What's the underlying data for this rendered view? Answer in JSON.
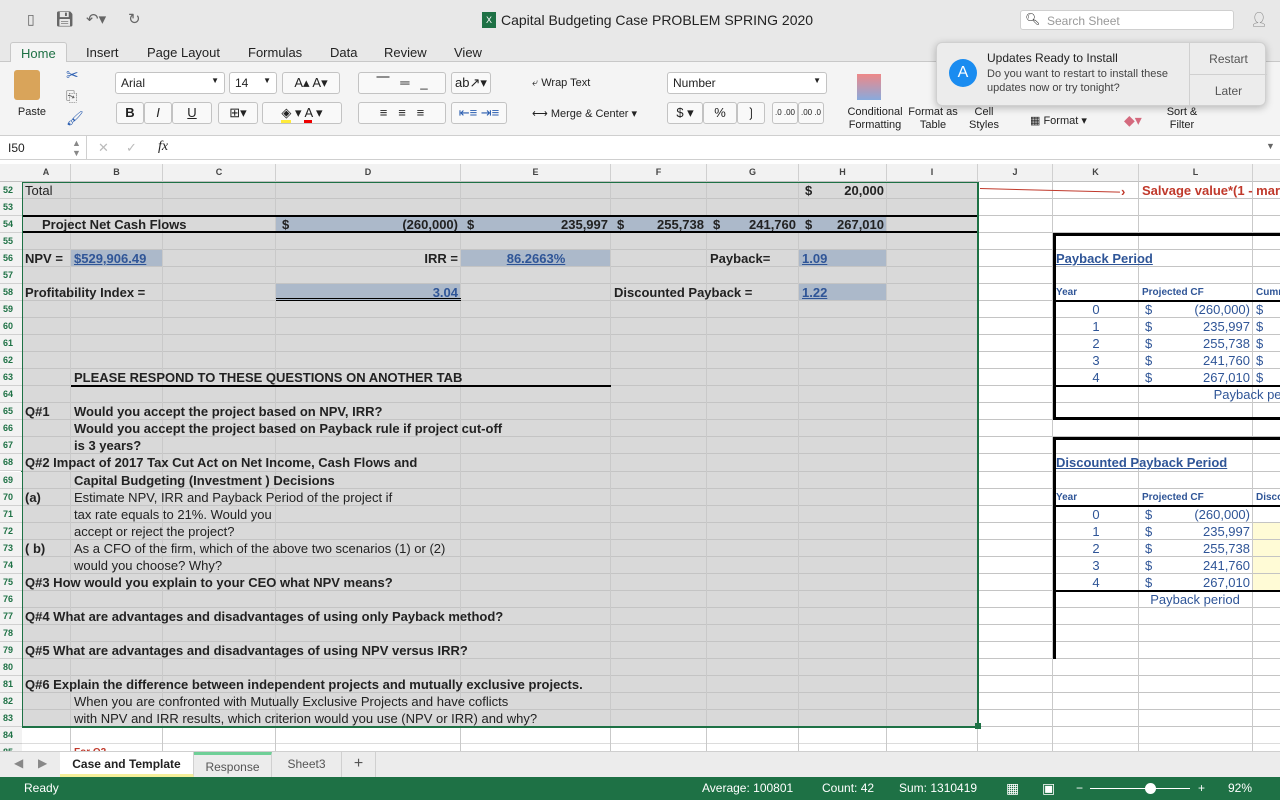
{
  "window": {
    "title": "Capital Budgeting Case PROBLEM SPRING 2020",
    "search_placeholder": "Search Sheet"
  },
  "ribbon_tabs": [
    "Home",
    "Insert",
    "Page Layout",
    "Formulas",
    "Data",
    "Review",
    "View"
  ],
  "ribbon": {
    "paste": "Paste",
    "font": "Arial",
    "font_size": "14",
    "bold": "B",
    "italic": "I",
    "underline": "U",
    "wrap_text": "Wrap Text",
    "merge_center": "Merge & Center",
    "number_format": "Number",
    "currency": "$",
    "percent": "%",
    "comma": "❳",
    "inc_dec": ".0 .00",
    "dec_dec": ".00 .0",
    "conditional_formatting": "Conditional Formatting",
    "format_as_table": "Format as Table",
    "cell_styles": "Cell Styles",
    "format": "Format",
    "sort_filter": "Sort & Filter"
  },
  "notification": {
    "title": "Updates Ready to Install",
    "body": "Do you want to restart to install these updates now or try tonight?",
    "restart": "Restart",
    "later": "Later"
  },
  "formula_bar": {
    "name_box": "I50",
    "fx": "fx",
    "value": ""
  },
  "columns": [
    "A",
    "B",
    "C",
    "D",
    "E",
    "F",
    "G",
    "H",
    "I",
    "J",
    "K",
    "L"
  ],
  "rows": [
    52,
    53,
    54,
    55,
    56,
    57,
    58,
    59,
    60,
    61,
    62,
    63,
    64,
    65,
    66,
    67,
    68,
    69,
    70,
    71,
    72,
    73,
    74,
    75,
    76,
    77,
    78,
    79,
    80,
    81,
    82,
    83,
    84,
    85
  ],
  "cells": [
    {
      "ref": "A52",
      "text": "Total"
    },
    {
      "ref": "H52",
      "cur": "$",
      "text": "20,000"
    },
    {
      "ref": "L52",
      "text": "Salvage value*(1 - mar"
    },
    {
      "ref": "A54",
      "text": "Project Net Cash Flows"
    },
    {
      "ref": "D54",
      "cur": "$",
      "text": "(260,000)"
    },
    {
      "ref": "E54",
      "cur": "$",
      "text": "235,997"
    },
    {
      "ref": "F54",
      "cur": "$",
      "text": "255,738"
    },
    {
      "ref": "G54",
      "cur": "$",
      "text": "241,760"
    },
    {
      "ref": "H54",
      "cur": "$",
      "text": "267,010"
    },
    {
      "ref": "A56",
      "text": "NPV ="
    },
    {
      "ref": "B56",
      "text": "$529,906.49"
    },
    {
      "ref": "D56",
      "text": "IRR ="
    },
    {
      "ref": "E56",
      "text": "86.2663%"
    },
    {
      "ref": "G56",
      "text": "Payback="
    },
    {
      "ref": "H56",
      "text": "1.09"
    },
    {
      "ref": "A58",
      "text": "Profitability Index  ="
    },
    {
      "ref": "D58",
      "text": "3.04"
    },
    {
      "ref": "F58",
      "text": "Discounted Payback ="
    },
    {
      "ref": "H58",
      "text": "1.22"
    },
    {
      "ref": "B63",
      "text": "PLEASE RESPOND TO THESE QUESTIONS ON ANOTHER TAB"
    },
    {
      "ref": "A65",
      "text": "Q#1"
    },
    {
      "ref": "B65",
      "text": "Would you accept the project based on NPV, IRR?"
    },
    {
      "ref": "B66",
      "text": "Would you accept the project based on Payback rule if project cut-off"
    },
    {
      "ref": "B67",
      "text": "is 3 years?"
    },
    {
      "ref": "A68",
      "text": "Q#2   Impact of 2017 Tax Cut Act on  Net Income, Cash Flows and"
    },
    {
      "ref": "B69",
      "text": "Capital Budgeting (Investment ) Decisions"
    },
    {
      "ref": "A70",
      "text": "(a)"
    },
    {
      "ref": "B70",
      "text": "Estimate NPV, IRR and Payback Period of the project if"
    },
    {
      "ref": "B71",
      "text": " tax rate  equals to 21%.  Would you"
    },
    {
      "ref": "B72",
      "text": "accept  or reject the project?"
    },
    {
      "ref": "A73",
      "text": "( b)"
    },
    {
      "ref": "B73",
      "text": "As a CFO of the firm, which of the above two  scenarios (1) or (2)"
    },
    {
      "ref": "B74",
      "text": "would you choose? Why?"
    },
    {
      "ref": "A75",
      "text": "Q#3  How would you  explain to your CEO what NPV means?"
    },
    {
      "ref": "A77",
      "text": "Q#4  What are  advantages and disadvantages of using only Payback method?"
    },
    {
      "ref": "A79",
      "text": "Q#5  What are advantages and disadvantages of using NPV versus IRR?"
    },
    {
      "ref": "A81",
      "text": "Q#6  Explain the difference between independent projects and mutually exclusive projects."
    },
    {
      "ref": "B82",
      "text": "When you are confronted with Mutually Exclusive Projects and have coflicts"
    },
    {
      "ref": "B83",
      "text": "with NPV and IRR results, which criterion would you use (NPV or IRR) and why?"
    },
    {
      "ref": "B85",
      "text": "For Q2"
    },
    {
      "ref": "K56",
      "text": "Payback Period"
    },
    {
      "ref": "K58",
      "text": "Year"
    },
    {
      "ref": "L58",
      "text": "Projected CF"
    },
    {
      "ref": "M58",
      "text": "Cumm"
    },
    {
      "ref": "K59",
      "text": "0"
    },
    {
      "ref": "L59",
      "cur": "$",
      "text": "(260,000)"
    },
    {
      "ref": "M59",
      "text": "$"
    },
    {
      "ref": "K60",
      "text": "1"
    },
    {
      "ref": "L60",
      "cur": "$",
      "text": "235,997"
    },
    {
      "ref": "M60",
      "text": "$"
    },
    {
      "ref": "K61",
      "text": "2"
    },
    {
      "ref": "L61",
      "cur": "$",
      "text": "255,738"
    },
    {
      "ref": "M61",
      "text": "$"
    },
    {
      "ref": "K62",
      "text": "3"
    },
    {
      "ref": "L62",
      "cur": "$",
      "text": "241,760"
    },
    {
      "ref": "M62",
      "text": "$"
    },
    {
      "ref": "K63",
      "text": "4"
    },
    {
      "ref": "L63",
      "cur": "$",
      "text": "267,010"
    },
    {
      "ref": "M63",
      "text": "$"
    },
    {
      "ref": "L64",
      "text": "Payback perio"
    },
    {
      "ref": "K68",
      "text": "Discounted Payback Period"
    },
    {
      "ref": "K70",
      "text": "Year"
    },
    {
      "ref": "L70",
      "text": "Projected CF"
    },
    {
      "ref": "M70",
      "text": "Disco"
    },
    {
      "ref": "K71",
      "text": "0"
    },
    {
      "ref": "L71",
      "cur": "$",
      "text": "(260,000)"
    },
    {
      "ref": "K72",
      "text": "1"
    },
    {
      "ref": "L72",
      "cur": "$",
      "text": "235,997"
    },
    {
      "ref": "K73",
      "text": "2"
    },
    {
      "ref": "L73",
      "cur": "$",
      "text": "255,738"
    },
    {
      "ref": "K74",
      "text": "3"
    },
    {
      "ref": "L74",
      "cur": "$",
      "text": "241,760"
    },
    {
      "ref": "K75",
      "text": "4"
    },
    {
      "ref": "L75",
      "cur": "$",
      "text": "267,010"
    },
    {
      "ref": "L76",
      "text": "Payback period"
    }
  ],
  "sheet_tabs": [
    {
      "label": "Case and Template",
      "active": true
    },
    {
      "label": "Response"
    },
    {
      "label": "Sheet3"
    }
  ],
  "add_sheet": "+",
  "status": {
    "ready": "Ready",
    "average": "Average: 100801",
    "count": "Count: 42",
    "sum": "Sum: 1310419",
    "zoom": "92%",
    "zoom_level": 92
  },
  "colors": {
    "accent": "#1e7145",
    "fill_blue": "#acb9ca",
    "shade": "#d9d9d9",
    "link": "#2f5597",
    "note_red": "#c0392b",
    "highlight_yellow": "#fffbd6"
  }
}
